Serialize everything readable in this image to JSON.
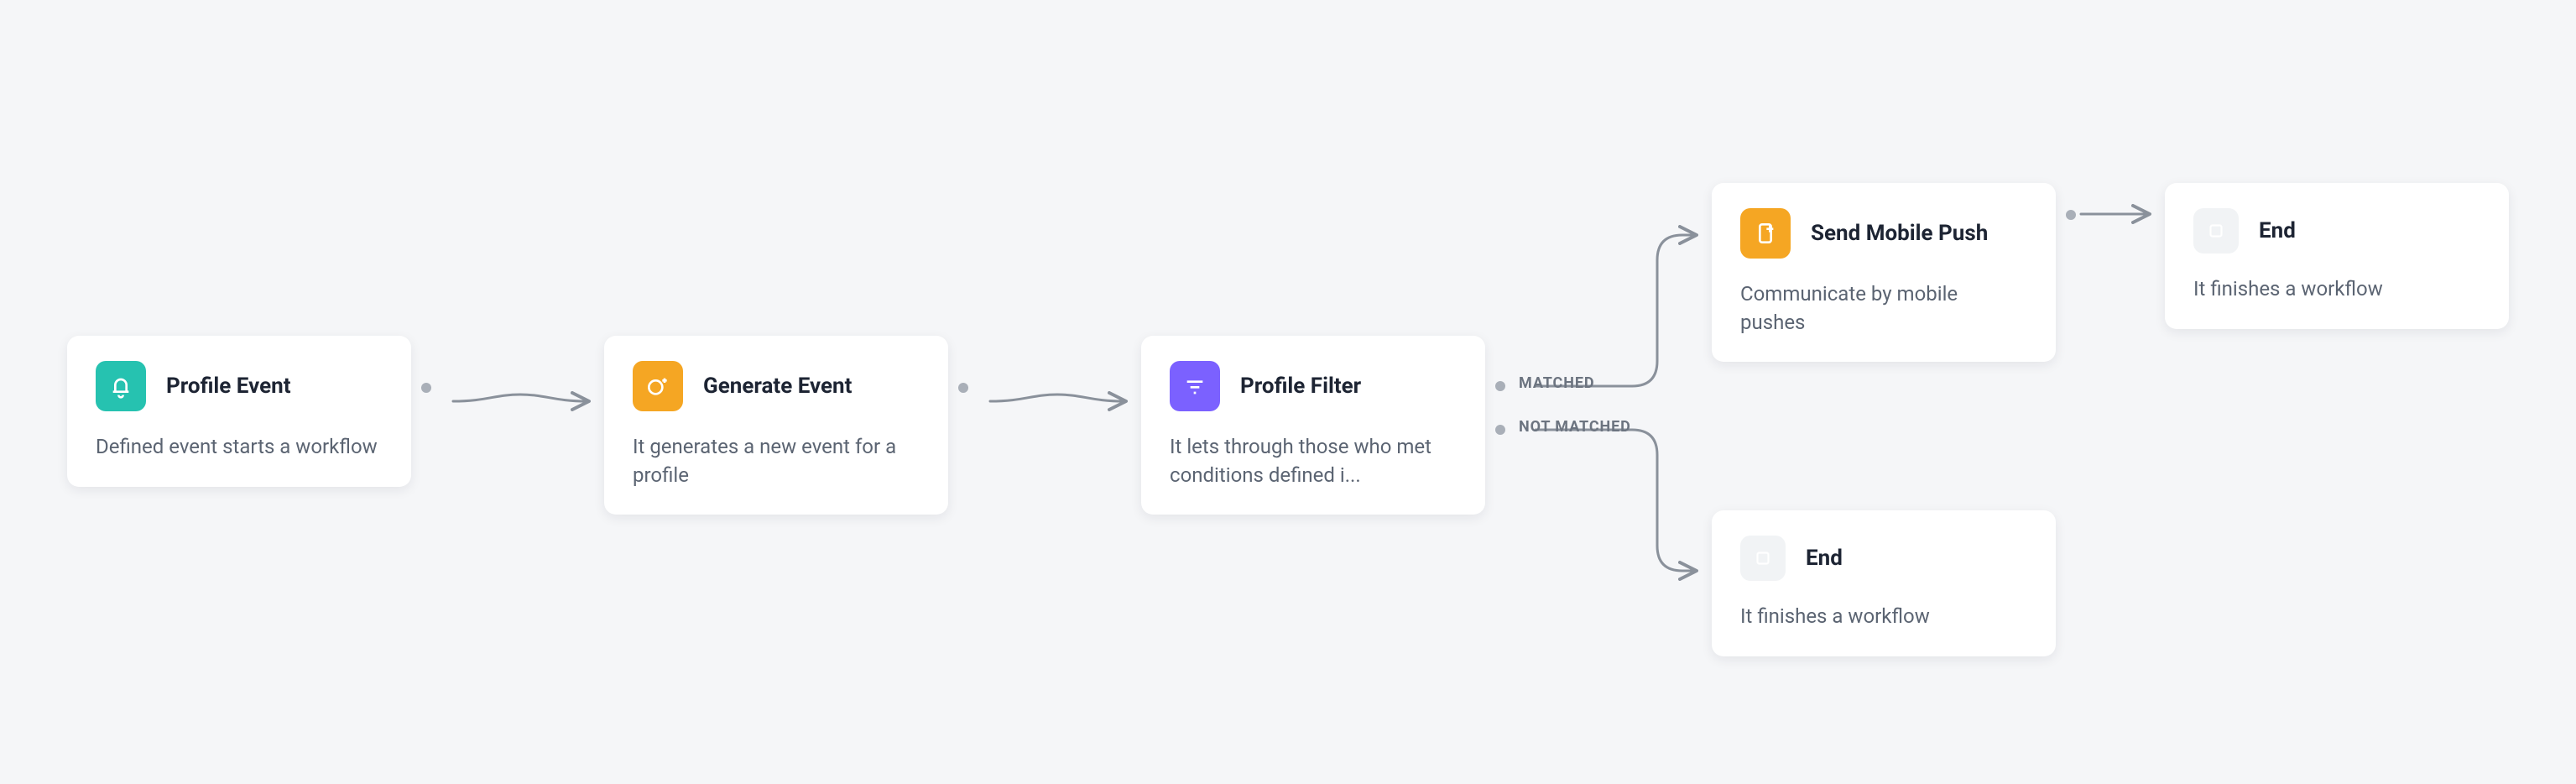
{
  "nodes": {
    "profile_event": {
      "title": "Profile Event",
      "desc": "Defined event starts a workflow"
    },
    "generate_event": {
      "title": "Generate Event",
      "desc": "It generates a new event for a profile"
    },
    "profile_filter": {
      "title": "Profile Filter",
      "desc": "It lets through those who met conditions defined i..."
    },
    "send_push": {
      "title": "Send Mobile Push",
      "desc": "Communicate by mobile pushes"
    },
    "end_top": {
      "title": "End",
      "desc": "It finishes a workflow"
    },
    "end_bottom": {
      "title": "End",
      "desc": "It finishes a workflow"
    }
  },
  "labels": {
    "matched": "MATCHED",
    "not_matched": "NOT MATCHED"
  }
}
